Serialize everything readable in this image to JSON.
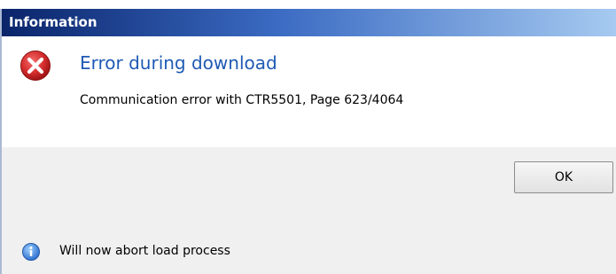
{
  "window": {
    "title": "Information"
  },
  "dialog": {
    "heading": "Error during download",
    "message": "Communication error with CTR5501, Page 623/4064",
    "icon": "error-icon",
    "heading_color": "#1f5ab5"
  },
  "buttons": {
    "ok_label": "OK"
  },
  "footer": {
    "icon": "info-icon",
    "text": "Will now abort load process"
  },
  "colors": {
    "titlebar_start": "#0a246a",
    "titlebar_end": "#a6caf0",
    "error_red": "#d62e2e",
    "panel_bg": "#f0f0f0"
  }
}
